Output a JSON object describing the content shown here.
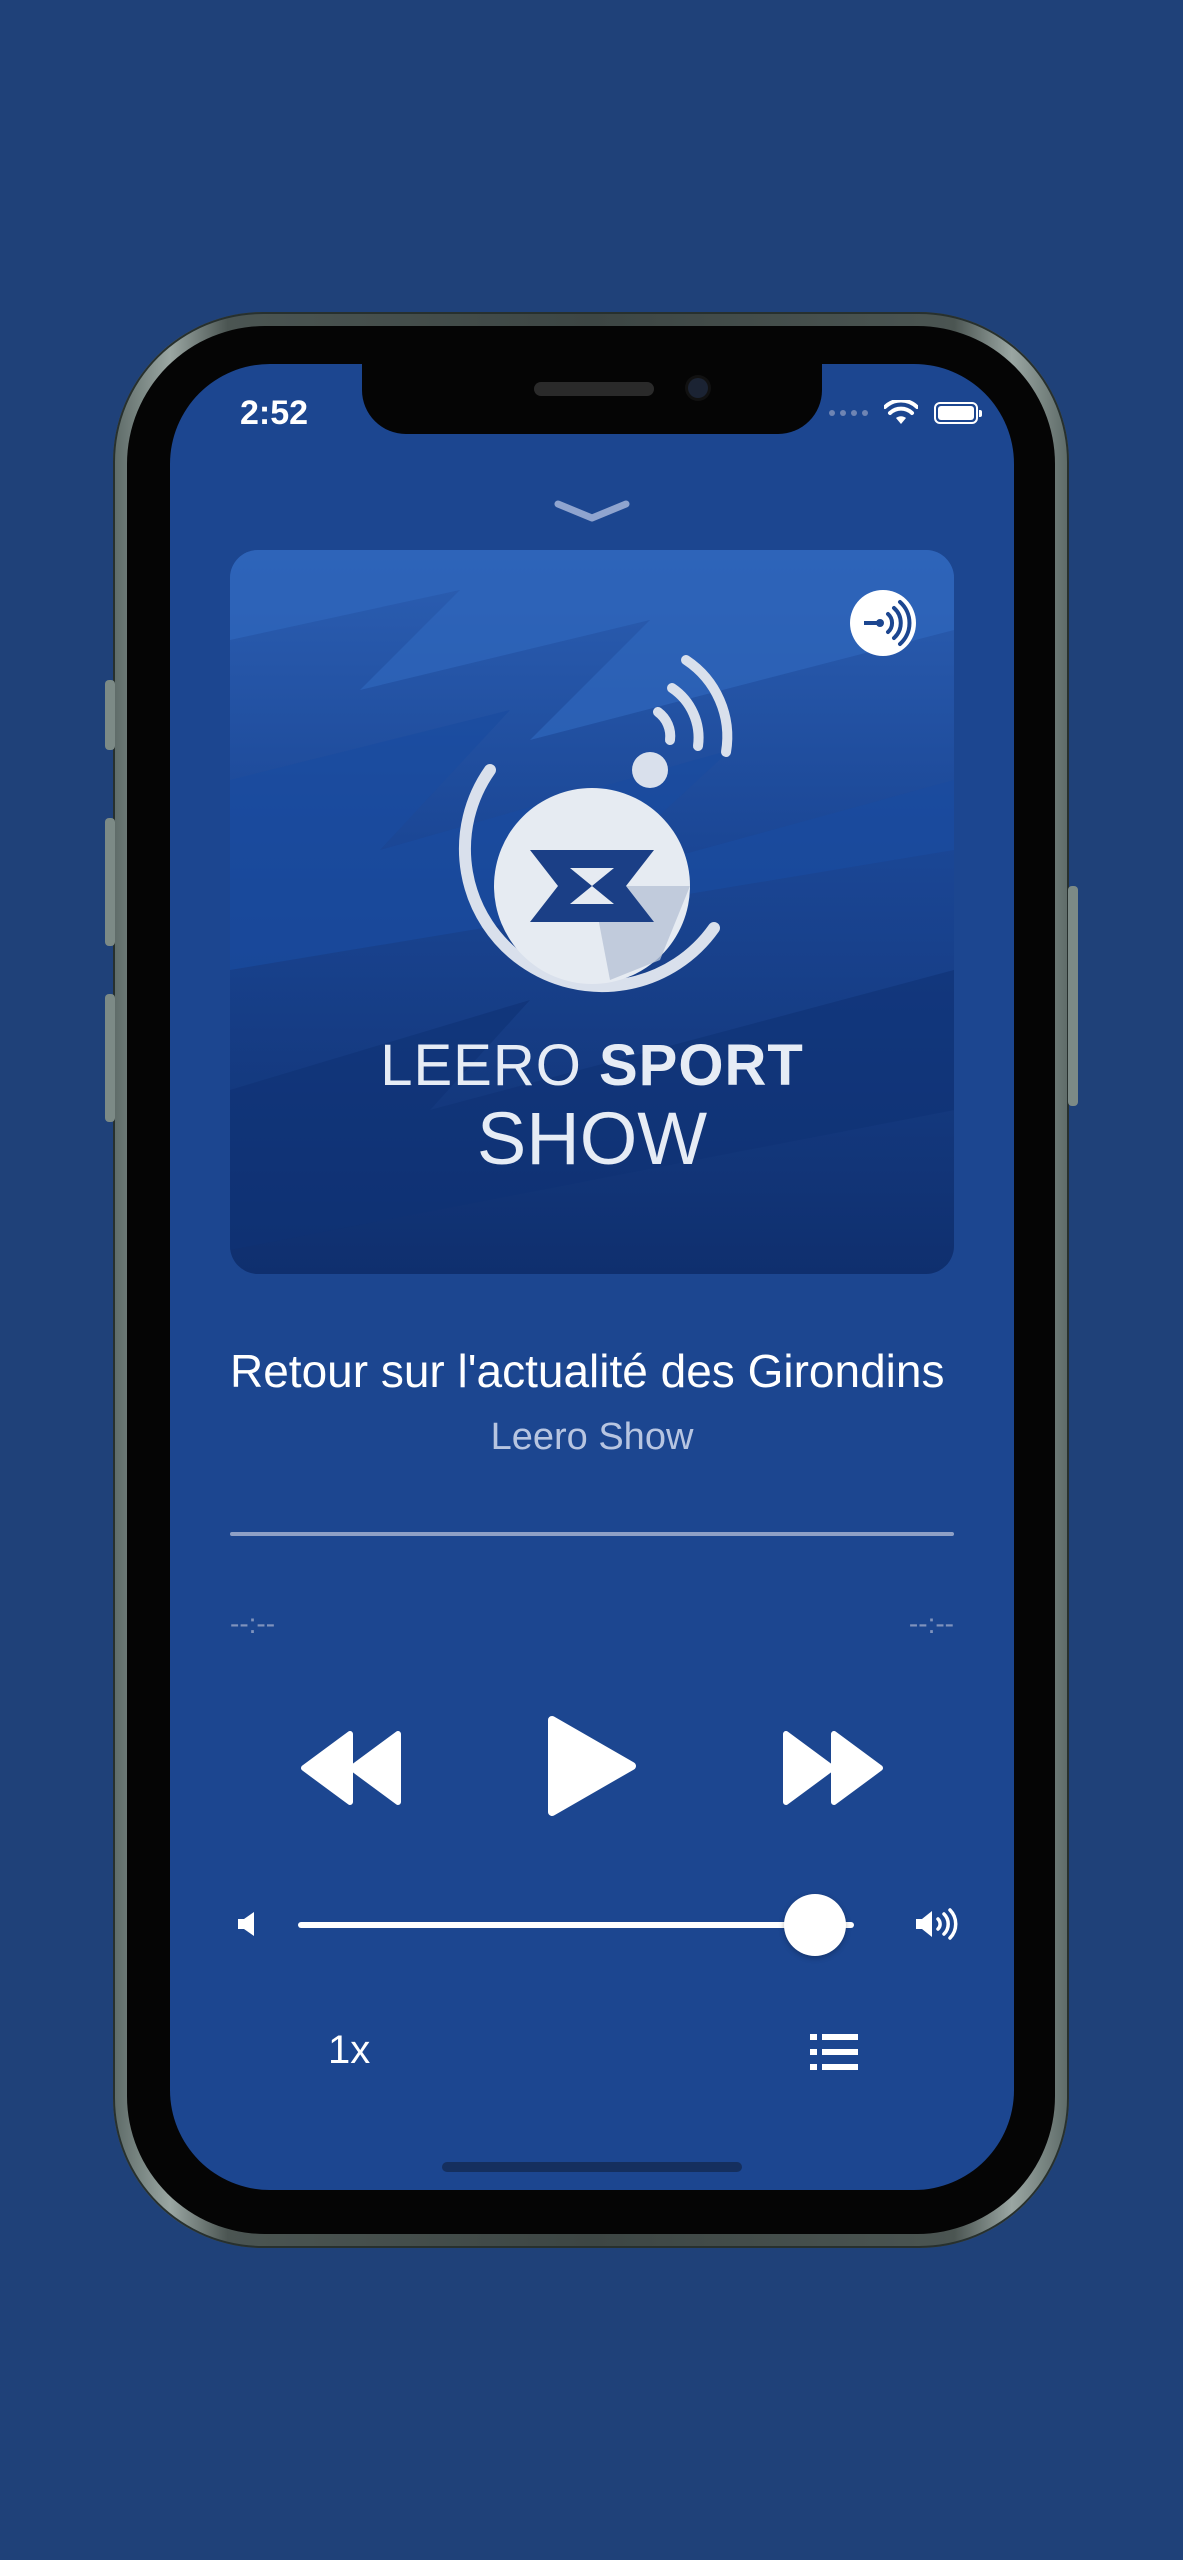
{
  "status_bar": {
    "time": "2:52"
  },
  "artwork": {
    "brand_line1_light": "LEERO",
    "brand_line1_bold": "SPORT",
    "brand_line2": "SHOW"
  },
  "player": {
    "track_title": "Retour sur l'actualité des Girondins",
    "artist": "Leero Show",
    "elapsed": "--:--",
    "remaining": "--:--",
    "volume_level": 0.93,
    "speed": "1x"
  },
  "icons": {
    "collapse": "chevron-down-icon",
    "badge": "anchor-podcast-icon",
    "rewind": "rewind-icon",
    "play": "play-icon",
    "forward": "fast-forward-icon",
    "volume_low": "speaker-low-icon",
    "volume_high": "speaker-high-icon",
    "queue": "list-icon"
  },
  "colors": {
    "background": "#1f4179",
    "screen": "#1c4690",
    "accent": "#ffffff"
  }
}
